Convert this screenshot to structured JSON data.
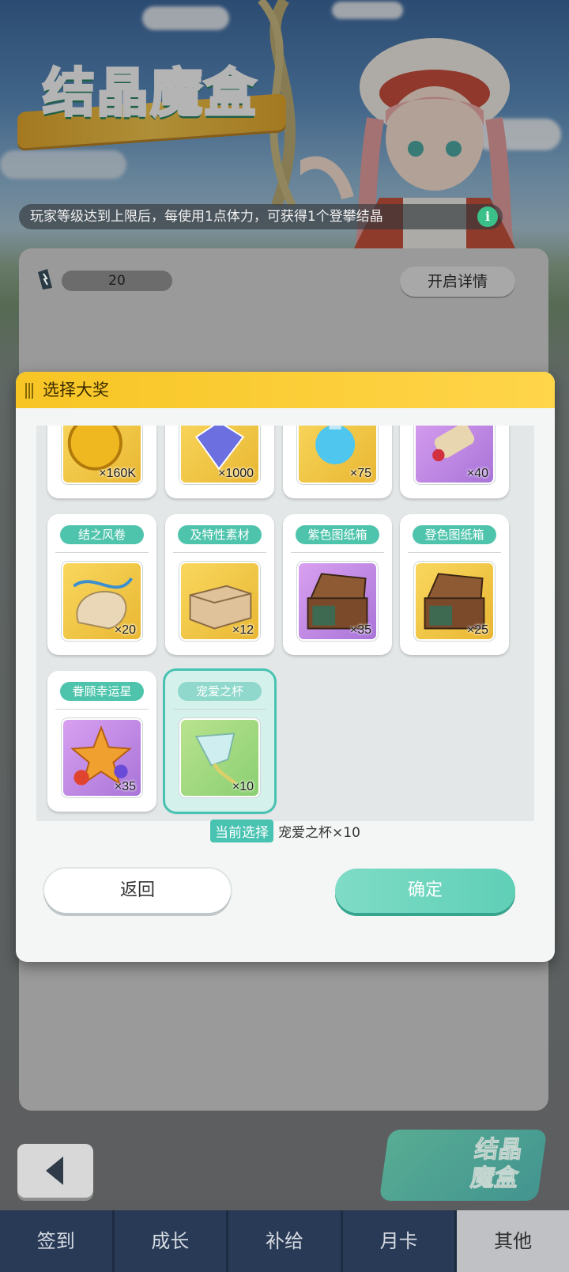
{
  "logo_text": "结晶魔盒",
  "notice": "玩家等级达到上限后，每使用1点体力，可获得1个登攀结晶",
  "stamina_value": "20",
  "details_button": "开启详情",
  "modal": {
    "title": "选择大奖",
    "top_row": [
      {
        "qty": "×160K"
      },
      {
        "qty": "×1000"
      },
      {
        "qty": "×75"
      },
      {
        "qty": "×40"
      }
    ],
    "cards": [
      {
        "label": "结之风卷",
        "qty": "×20"
      },
      {
        "label": "及特性素材",
        "qty": "×12"
      },
      {
        "label": "紫色图纸箱",
        "qty": "×35"
      },
      {
        "label": "登色图纸箱",
        "qty": "×25"
      },
      {
        "label": "眷顾幸运星",
        "qty": "×35"
      },
      {
        "label": "宠爱之杯",
        "qty": "×10"
      }
    ],
    "current_selection_label": "当前选择",
    "current_selection_value": "宠爱之杯×10",
    "return_button": "返回",
    "confirm_button": "确定"
  },
  "badge_text": "结晶魔盒",
  "tabs": [
    "签到",
    "成长",
    "补给",
    "月卡",
    "其他"
  ],
  "colors": {
    "accent": "#48c2b1",
    "header": "#f7c524",
    "tabbar": "#283a56"
  }
}
